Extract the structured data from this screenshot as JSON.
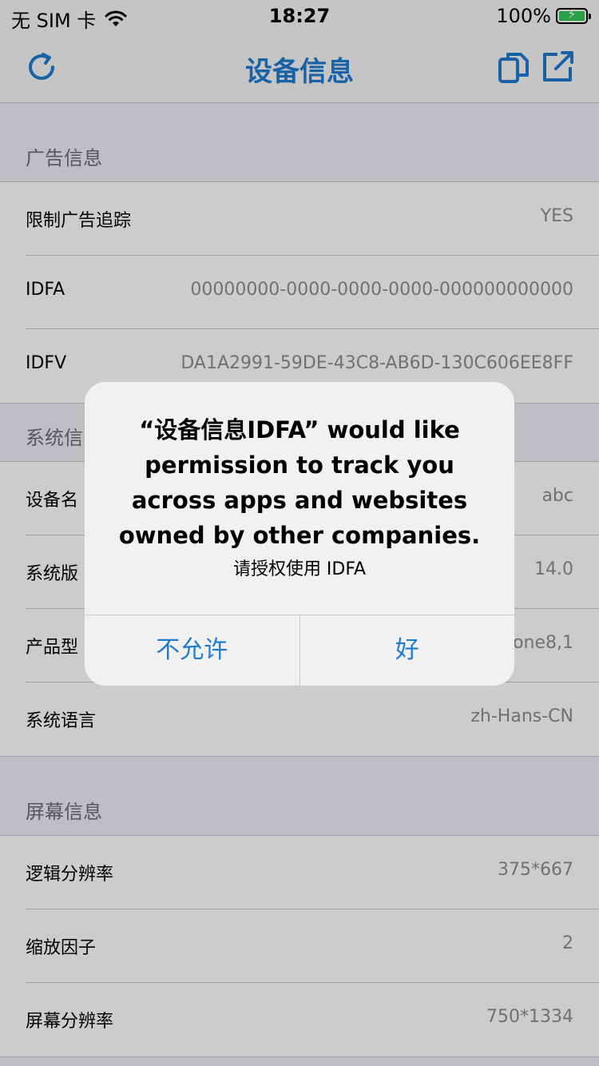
{
  "status_bar": {
    "carrier": "无 SIM 卡",
    "time": "18:27",
    "battery": "100%"
  },
  "nav": {
    "title": "设备信息",
    "left_icon": "refresh-icon",
    "right_icons": [
      "copy-icon",
      "share-icon"
    ]
  },
  "sections": [
    {
      "header": "广告信息",
      "rows": [
        {
          "label": "限制广告追踪",
          "value": "YES"
        },
        {
          "label": "IDFA",
          "value": "00000000-0000-0000-0000-000000000000"
        },
        {
          "label": "IDFV",
          "value": "DA1A2991-59DE-43C8-AB6D-130C606EE8FF"
        }
      ]
    },
    {
      "header": "系统信",
      "rows": [
        {
          "label": "设备名",
          "value": "abc"
        },
        {
          "label": "系统版",
          "value": "14.0"
        },
        {
          "label": "产品型",
          "value": "one8,1"
        },
        {
          "label": "系统语言",
          "value": "zh-Hans-CN"
        }
      ]
    },
    {
      "header": "屏幕信息",
      "rows": [
        {
          "label": "逻辑分辨率",
          "value": "375*667"
        },
        {
          "label": "缩放因子",
          "value": "2"
        },
        {
          "label": "屏幕分辨率",
          "value": "750*1334"
        }
      ]
    }
  ],
  "alert": {
    "title": "“设备信息IDFA” would like permission to track you across apps and websites owned by other companies.",
    "message": "请授权使用 IDFA",
    "buttons": [
      "不允许",
      "好"
    ]
  },
  "colors": {
    "accent": "#1e7bd1",
    "background": "#efeff4"
  }
}
